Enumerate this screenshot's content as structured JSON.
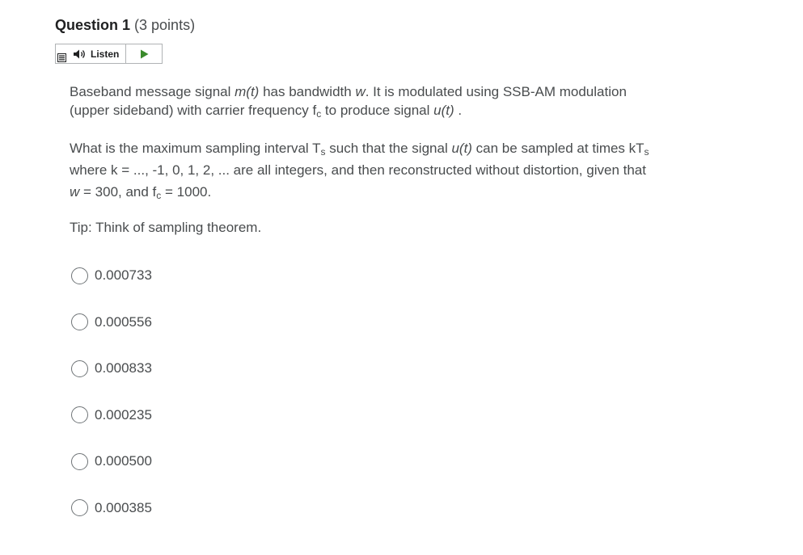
{
  "question": {
    "title": "Question 1",
    "points": "(3 points)"
  },
  "listen": {
    "label": "Listen"
  },
  "body": {
    "p1": {
      "a": "Baseband message signal ",
      "m": "m(t)",
      "b": " has bandwidth ",
      "w": "w",
      "c": ". It is modulated using SSB-AM modulation (upper sideband) with carrier frequency f",
      "sub_c": "c",
      "d": " to produce signal ",
      "u": "u(t)",
      "e": " ."
    },
    "p2": {
      "a": "What is the maximum sampling interval T",
      "sub_s1": "s",
      "b": " such that the signal ",
      "u": "u(t)",
      "c": "  can be sampled at times kT",
      "sub_s2": "s",
      "d": " where k = ..., -1, 0, 1, 2, ... are all integers, and then reconstructed without distortion, given that ",
      "w": "w",
      "e": " = 300, and f",
      "sub_c": "c",
      "f": " = 1000."
    },
    "p3": "Tip: Think of sampling theorem."
  },
  "options": [
    {
      "label": "0.000733",
      "selected": false
    },
    {
      "label": "0.000556",
      "selected": false
    },
    {
      "label": "0.000833",
      "selected": false
    },
    {
      "label": "0.000235",
      "selected": false
    },
    {
      "label": "0.000500",
      "selected": false
    },
    {
      "label": "0.000385",
      "selected": false
    }
  ],
  "icons": {
    "menu": "menu-icon",
    "speaker": "speaker-icon",
    "play": "play-icon"
  },
  "colors": {
    "play_green": "#3a8a2c",
    "text": "#494c4e",
    "title": "#202122"
  }
}
